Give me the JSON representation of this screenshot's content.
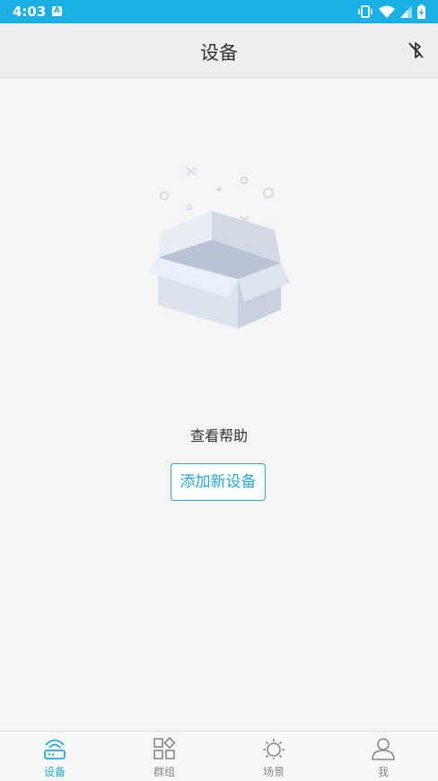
{
  "status_bar": {
    "time": "4:03",
    "app_icon_letter": "A"
  },
  "app_bar": {
    "title": "设备",
    "bluetooth_icon": "bluetooth-off-icon"
  },
  "empty_state": {
    "illustration": "empty-box-illustration",
    "help_link": "查看帮助",
    "add_button": "添加新设备"
  },
  "tab_bar": {
    "active_color": "#25a9d9",
    "inactive_color": "#888888",
    "tabs": [
      {
        "label": "设备",
        "icon": "router-icon",
        "active": true
      },
      {
        "label": "群组",
        "icon": "group-grid-icon",
        "active": false
      },
      {
        "label": "场景",
        "icon": "sun-icon",
        "active": false
      },
      {
        "label": "我",
        "icon": "person-icon",
        "active": false
      }
    ]
  },
  "colors": {
    "status_bar": "#1ab0e6",
    "accent": "#25a9d9"
  }
}
